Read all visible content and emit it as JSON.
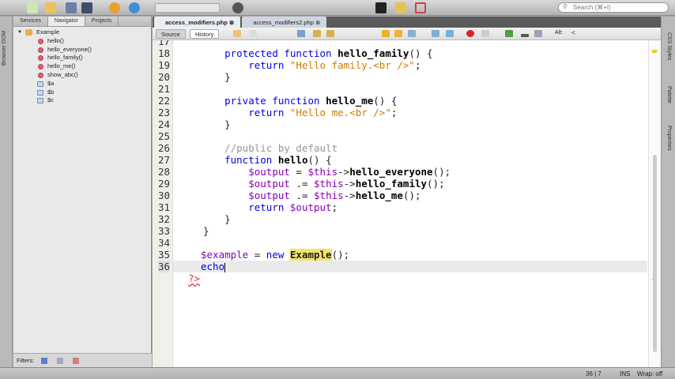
{
  "toolbar": {
    "search_placeholder": "Search (⌘+I)",
    "icons": [
      "new-file-icon",
      "new-project-icon",
      "open-project-icon",
      "save-all-icon",
      "preview-icon",
      "undo-icon",
      "redo-icon",
      "config-dropdown",
      "run-icon",
      "build-icon",
      "clean-icon",
      "debug-icon",
      "profile-icon",
      "terminal-icon",
      "library-icon",
      "tools-icon",
      "git-icon"
    ]
  },
  "left_strip": {
    "label": "Browser DOM"
  },
  "right_strip": {
    "labels": [
      "CSS Styles",
      "Palette",
      "Properties"
    ]
  },
  "navigator": {
    "tabs": [
      "Services",
      "Navigator",
      "Projects"
    ],
    "active_tab": "Navigator",
    "root": "Example",
    "items": [
      {
        "label": "hello()",
        "type": "method"
      },
      {
        "label": "hello_everyone()",
        "type": "method"
      },
      {
        "label": "hello_family()",
        "type": "method"
      },
      {
        "label": "hello_me()",
        "type": "method"
      },
      {
        "label": "show_abc()",
        "type": "method"
      },
      {
        "label": "$a",
        "type": "field"
      },
      {
        "label": "$b",
        "type": "field"
      },
      {
        "label": "$c",
        "type": "field"
      }
    ],
    "filters_label": "Filters:"
  },
  "editor": {
    "tabs": [
      {
        "label": "access_modifiers.php",
        "active": true
      },
      {
        "label": "access_modifiers2.php",
        "active": false
      }
    ],
    "source_label": "Source",
    "history_label": "History",
    "alt_label": "Alt:",
    "lt_label": "<",
    "line_numbers": [
      "17",
      "18",
      "19",
      "20",
      "21",
      "22",
      "23",
      "24",
      "25",
      "26",
      "27",
      "28",
      "29",
      "30",
      "31",
      "32",
      "33",
      "34",
      "35",
      "36"
    ],
    "code": {
      "l18": [
        "protected",
        "function",
        "hello_family",
        "() {"
      ],
      "l19": [
        "return",
        "\"Hello family.<br />\"",
        ";"
      ],
      "l20": "}",
      "l22": [
        "private",
        "function",
        "hello_me",
        "() {"
      ],
      "l23": [
        "return",
        "\"Hello me.<br />\"",
        ";"
      ],
      "l24": "}",
      "l26": "//public by default",
      "l27": [
        "function",
        "hello",
        "() {"
      ],
      "l28": [
        "$output",
        " = ",
        "$this",
        "->",
        "hello_everyone",
        "();"
      ],
      "l29": [
        "$output",
        " .= ",
        "$this",
        "->",
        "hello_family",
        "();"
      ],
      "l30": [
        "$output",
        " .= ",
        "$this",
        "->",
        "hello_me",
        "();"
      ],
      "l31": [
        "return",
        " ",
        "$output",
        ";"
      ],
      "l32": "}",
      "l33": "}",
      "l35": [
        "$example",
        " = ",
        "new",
        " ",
        "Example",
        "();"
      ],
      "l36": "echo",
      "l37": "?>"
    },
    "current_line": 36
  },
  "status": {
    "position": "36 | 7",
    "mode": "INS",
    "wrap": "Wrap: off"
  }
}
